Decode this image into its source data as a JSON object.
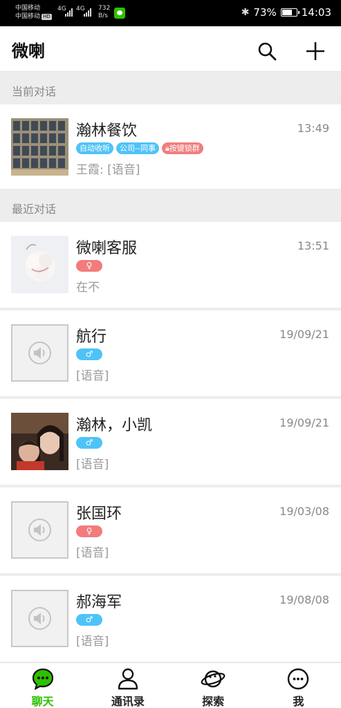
{
  "status_bar": {
    "carrier1": "中国移动",
    "carrier2": "中国移动",
    "hd": "HD",
    "net1": "4G",
    "net2": "4G",
    "speed_value": "732",
    "speed_unit": "B/s",
    "battery_percent": "73%",
    "battery_level": 0.73,
    "time": "14:03"
  },
  "header": {
    "title": "微喇",
    "search_icon": "search-icon",
    "add_icon": "plus-icon"
  },
  "sections": {
    "current": "当前对话",
    "recent": "最近对话"
  },
  "current_chats": [
    {
      "name": "瀚林餐饮",
      "time": "13:49",
      "tags": [
        "自动收听",
        "公司--同事",
        "按键锁群"
      ],
      "preview": "王霞: [语音]"
    }
  ],
  "recent_chats": [
    {
      "name": "微喇客服",
      "time": "13:51",
      "gender": "♀",
      "preview": "在不"
    },
    {
      "name": "航行",
      "time": "19/09/21",
      "gender": "♂",
      "preview": "[语音]"
    },
    {
      "name": "瀚林，小凯",
      "time": "19/09/21",
      "gender": "♂",
      "preview": "[语音]"
    },
    {
      "name": "张国环",
      "time": "19/03/08",
      "gender": "♀",
      "preview": "[语音]"
    },
    {
      "name": "郝海军",
      "time": "19/08/08",
      "gender": "♂",
      "preview": "[语音]"
    }
  ],
  "bottom_nav": [
    {
      "label": "聊天",
      "icon": "chat-icon",
      "active": true
    },
    {
      "label": "通讯录",
      "icon": "contacts-icon",
      "active": false
    },
    {
      "label": "探索",
      "icon": "planet-icon",
      "active": false
    },
    {
      "label": "我",
      "icon": "more-icon",
      "active": false
    }
  ],
  "colors": {
    "accent_green": "#2dc100",
    "tag_blue": "#4fc3f7",
    "tag_red": "#f27c7c"
  }
}
